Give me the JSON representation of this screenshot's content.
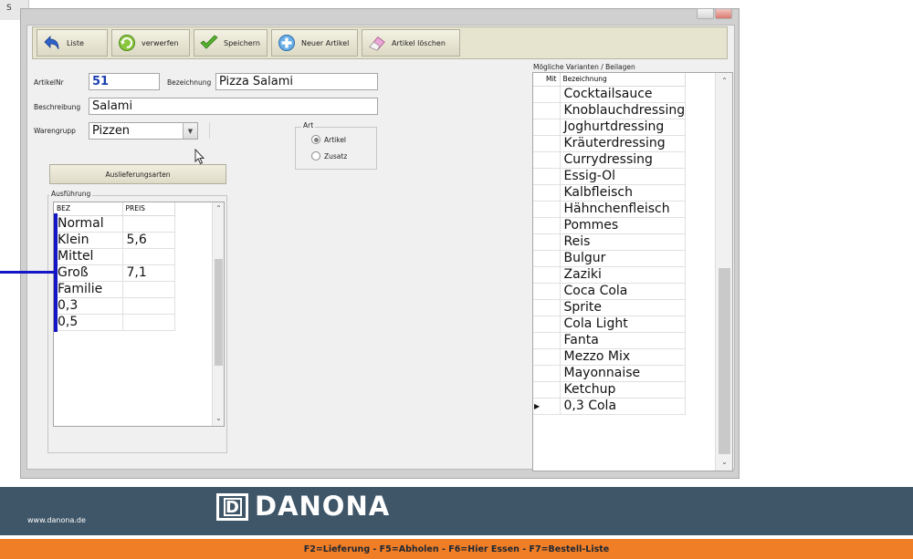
{
  "window": {
    "title_fragment": "S"
  },
  "toolbar": {
    "buttons": [
      {
        "label": "Liste",
        "icon": "back-arrow-icon"
      },
      {
        "label": "verwerfen",
        "icon": "discard-circle-icon"
      },
      {
        "label": "Speichern",
        "icon": "checkmark-icon"
      },
      {
        "label": "Neuer Artikel",
        "icon": "plus-circle-icon"
      },
      {
        "label": "Artikel löschen",
        "icon": "eraser-icon"
      }
    ]
  },
  "form": {
    "artikelnr_label": "ArtikelNr",
    "artikelnr_value": "51",
    "bezeichnung_label": "Bezeichnung",
    "bezeichnung_value": "Pizza Salami",
    "beschreibung_label": "Beschreibung",
    "beschreibung_value": "Salami",
    "warengrupp_label": "Warengrupp",
    "warengrupp_value": "Pizzen",
    "art_label": "Art",
    "art_options": [
      {
        "label": "Artikel",
        "selected": true
      },
      {
        "label": "Zusatz",
        "selected": false
      }
    ],
    "auslieferungsarten_label": "Auslieferungsarten"
  },
  "ausfuehrung": {
    "title": "Ausführung",
    "columns": [
      "BEZ",
      "PREIS"
    ],
    "rows": [
      [
        "Normal",
        ""
      ],
      [
        "Klein",
        "5,6"
      ],
      [
        "Mittel",
        ""
      ],
      [
        "Groß",
        "7,1"
      ],
      [
        "Familie",
        ""
      ],
      [
        "0,3",
        ""
      ],
      [
        "0,5",
        ""
      ]
    ]
  },
  "varianten": {
    "title": "Mögliche Varianten / Beilagen",
    "columns": [
      "Mit",
      "Bezeichnung"
    ],
    "rows": [
      "Cocktailsauce",
      "Knoblauchdressing",
      "Joghurtdressing",
      "Kräuterdressing",
      "Currydressing",
      "Essig-Öl",
      "Kalbfleisch",
      "Hähnchenfleisch",
      "Pommes",
      "Reis",
      "Bulgur",
      "Zaziki",
      "Coca Cola",
      "Sprite",
      "Cola Light",
      "Fanta",
      "Mezzo Mix",
      "Mayonnaise",
      "Ketchup",
      "0,3 Cola"
    ],
    "current_row_index": 19
  },
  "footer": {
    "url": "www.danona.de",
    "logo_mark": "D",
    "logo_text": "DANONA",
    "hotkeys": "F2=Lieferung - F5=Abholen - F6=Hier Essen - F7=Bestell-Liste"
  },
  "colors": {
    "footer_band": "#3f5668",
    "hotkey_bar": "#f07e26",
    "annotation_bar": "#1515c8",
    "toolbar_bg": "#e6e3cf"
  }
}
